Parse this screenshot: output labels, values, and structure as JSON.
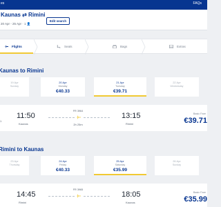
{
  "topbar": {
    "left_text": "es",
    "right_text": "FAQs"
  },
  "route": {
    "title": "Kaunas ⇄ Rimini",
    "subtitle": "20 Apr - 25 Apr  ·  1 👤",
    "edit_label": "Edit search"
  },
  "steps": [
    {
      "label": "Flights",
      "icon": "plane-icon",
      "active": true
    },
    {
      "label": "Seats",
      "icon": "seat-icon",
      "active": false
    },
    {
      "label": "Bags",
      "icon": "bag-icon",
      "active": false
    },
    {
      "label": "Extras",
      "icon": "extras-icon",
      "active": false
    }
  ],
  "outbound": {
    "title": "Kaunas to Rimini",
    "dates": [
      {
        "date": "19 Apr",
        "weekday": "Sunday",
        "price": ""
      },
      {
        "date": "20 Apr",
        "weekday": "Monday",
        "price": "€40.33"
      },
      {
        "date": "21 Apr",
        "weekday": "Tuesday",
        "price": "€39.71",
        "selected": true
      },
      {
        "date": "22 Apr",
        "weekday": "Wednesday",
        "price": ""
      }
    ],
    "flight": {
      "dep_time": "11:50",
      "dep_city": "Kaunas",
      "arr_time": "13:15",
      "arr_city": "Rimini",
      "flight_no": "FR 3964",
      "duration": "2h 25m",
      "left_tag": "1",
      "fare_label": "Basic Fare",
      "fare": "€39.71"
    }
  },
  "inbound": {
    "title": "Rimini to Kaunas",
    "dates": [
      {
        "date": "23 Apr",
        "weekday": "Thursday",
        "price": ""
      },
      {
        "date": "24 Apr",
        "weekday": "Friday",
        "price": "€40.33"
      },
      {
        "date": "25 Apr",
        "weekday": "Saturday",
        "price": "€35.99",
        "selected": true
      },
      {
        "date": "26 Apr",
        "weekday": "Sunday",
        "price": ""
      }
    ],
    "flight": {
      "dep_time": "14:45",
      "dep_city": "Rimini",
      "arr_time": "18:05",
      "arr_city": "Kaunas",
      "flight_no": "FR 3965",
      "duration": "",
      "fare_label": "Basic Fare",
      "fare": "€35.99"
    }
  },
  "colors": {
    "brand": "#073590",
    "accent": "#f1c933",
    "background": "#eef0f3"
  }
}
